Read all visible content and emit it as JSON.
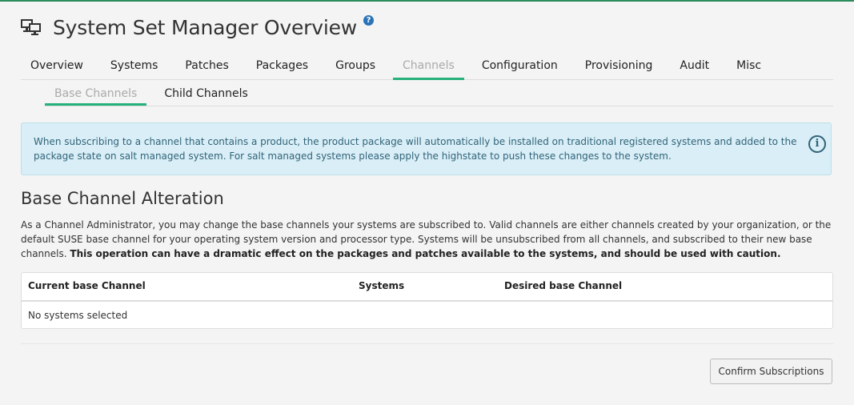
{
  "header": {
    "title": "System Set Manager Overview",
    "help_glyph": "?"
  },
  "tabs": [
    {
      "label": "Overview"
    },
    {
      "label": "Systems"
    },
    {
      "label": "Patches"
    },
    {
      "label": "Packages"
    },
    {
      "label": "Groups"
    },
    {
      "label": "Channels",
      "active": true
    },
    {
      "label": "Configuration"
    },
    {
      "label": "Provisioning"
    },
    {
      "label": "Audit"
    },
    {
      "label": "Misc"
    }
  ],
  "subtabs": [
    {
      "label": "Base Channels",
      "active": true
    },
    {
      "label": "Child Channels"
    }
  ],
  "alert": {
    "text": "When subscribing to a channel that contains a product, the product package will automatically be installed on traditional registered systems and added to the package state on salt managed system. For salt managed systems please apply the highstate to push these changes to the system.",
    "icon_glyph": "i"
  },
  "section": {
    "title": "Base Channel Alteration",
    "description": "As a Channel Administrator, you may change the base channels your systems are subscribed to. Valid channels are either channels created by your organization, or the default SUSE base channel for your operating system version and processor type. Systems will be unsubscribed from all channels, and subscribed to their new base channels.",
    "warning": "This operation can have a dramatic effect on the packages and patches available to the systems, and should be used with caution."
  },
  "table": {
    "headers": [
      "Current base Channel",
      "Systems",
      "Desired base Channel"
    ],
    "empty_message": "No systems selected"
  },
  "actions": {
    "confirm_label": "Confirm Subscriptions"
  },
  "colors": {
    "accent": "#26b07a",
    "alert_bg": "#d9eef6",
    "alert_text": "#31647a",
    "help_icon": "#2a73b8"
  },
  "icons": {
    "header": "systems-icon",
    "help": "help-icon",
    "alert": "info-icon"
  }
}
